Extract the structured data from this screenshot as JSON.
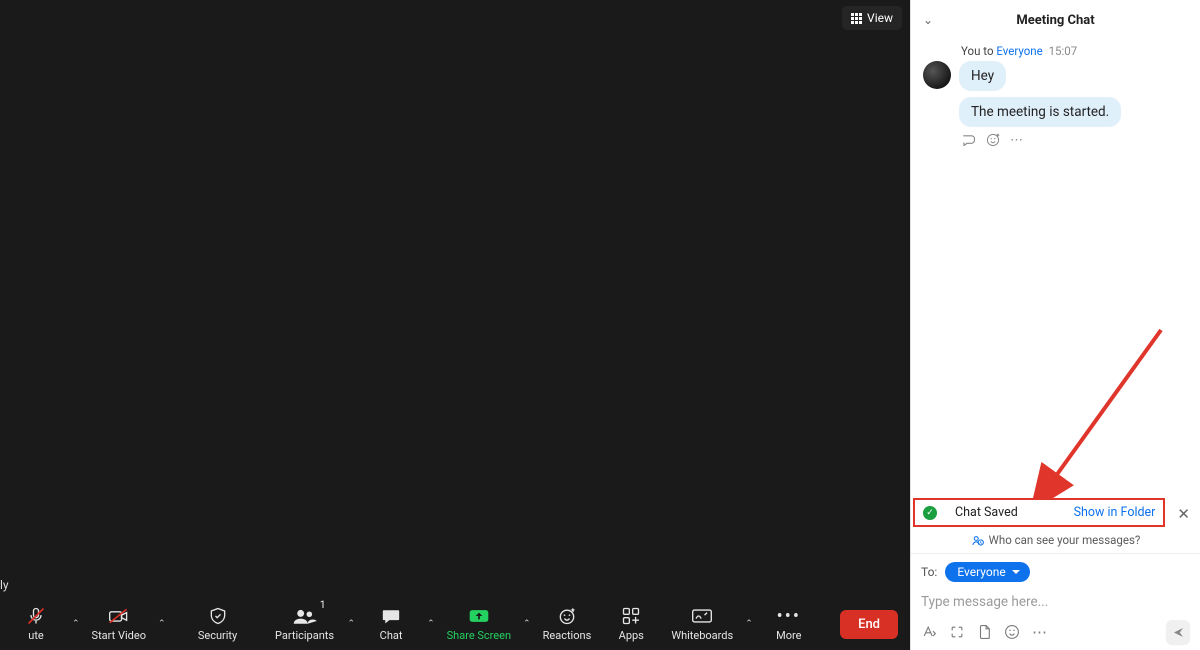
{
  "view_button": "View",
  "corner_text": "ly",
  "toolbar": {
    "mute": "ute",
    "start_video": "Start Video",
    "security": "Security",
    "participants": "Participants",
    "participants_count": "1",
    "chat": "Chat",
    "share_screen": "Share Screen",
    "reactions": "Reactions",
    "apps": "Apps",
    "whiteboards": "Whiteboards",
    "more": "More",
    "end": "End"
  },
  "chat": {
    "title": "Meeting Chat",
    "sender_prefix": "You to ",
    "recipient": "Everyone",
    "time": "15:07",
    "msg1": "Hey",
    "msg2": "The meeting is started.",
    "saved_label": "Chat Saved",
    "show_in_folder": "Show in Folder",
    "who_can_see": "Who can see your messages?",
    "to_label": "To:",
    "to_target": "Everyone",
    "placeholder": "Type message here...",
    "more_dots": "⋯"
  }
}
